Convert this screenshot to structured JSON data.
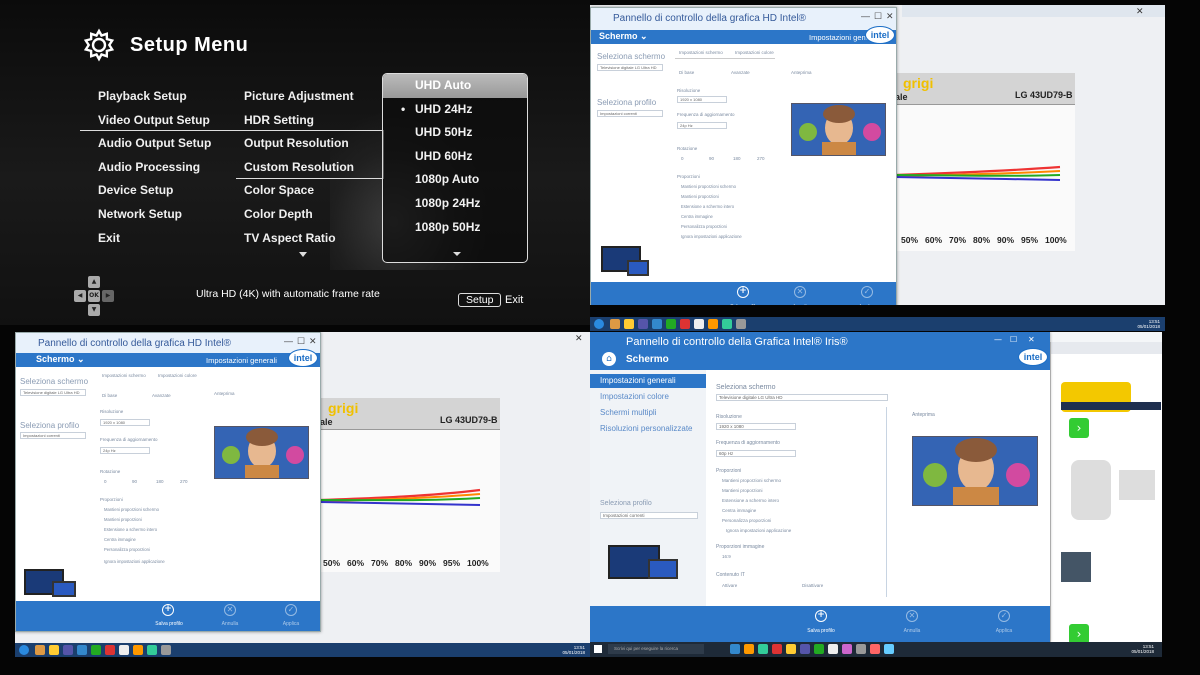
{
  "setup_menu": {
    "title": "Setup Menu",
    "main_items": [
      "Playback Setup",
      "Video Output Setup",
      "Audio Output Setup",
      "Audio Processing",
      "Device Setup",
      "Network Setup",
      "Exit"
    ],
    "sub_items": [
      "Picture Adjustment",
      "HDR Setting",
      "Output Resolution",
      "Custom Resolution",
      "Color Space",
      "Color Depth",
      "TV Aspect Ratio"
    ],
    "resolutions": [
      "UHD Auto",
      "UHD 24Hz",
      "UHD 50Hz",
      "UHD 60Hz",
      "1080p Auto",
      "1080p 24Hz",
      "1080p 50Hz"
    ],
    "selected_main": "Video Output Setup",
    "selected_sub": "Output Resolution",
    "highlighted_resolution": "UHD Auto",
    "checked_resolution": "UHD 24Hz",
    "dpad_center": "OK",
    "hint": "Ultra HD (4K) with automatic frame rate",
    "setup_key": "Setup",
    "exit_label": "Exit"
  },
  "intel_hd_win": {
    "title": "Pannello di controllo della grafica HD Intel®",
    "schermo": "Schermo ⌄",
    "impostazioni_generali": "Impostazioni generali",
    "logo": "intel",
    "seleziona_schermo": "Seleziona schermo",
    "seleziona_profilo": "Seleziona profilo",
    "display_value": "Televisione digitale LG Ultra HD",
    "profile_value": "Impostazioni correnti",
    "tab_schermo": "Impostazioni schermo",
    "tab_colore": "Impostazioni colore",
    "anteprima": "Anteprima",
    "di_base": "Di base",
    "avanzate": "Avanzate",
    "risoluzione": "Risoluzione",
    "res_value": "1920 x 1080",
    "frequenza": "Frequenza di aggiornamento",
    "freq_value": "24p Hz",
    "rotazione": "Rotazione",
    "rot_values": [
      "0",
      "90",
      "180",
      "270"
    ],
    "proporzioni": "Proporzioni",
    "prop_options": [
      "Mantieni proporzioni schermo",
      "Mantieni proporzioni",
      "Estensione a schermo intero",
      "Centra immagine",
      "Personalizza proporzioni",
      "Ignora impostazioni applicazione"
    ],
    "salva": "Salva profilo",
    "annulla": "Annulla",
    "applica": "Applica"
  },
  "intel_iris_win": {
    "title": "Pannello di controllo della Grafica Intel® Iris®",
    "schermo": "Schermo",
    "logo": "intel",
    "nav": [
      "Impostazioni generali",
      "Impostazioni colore",
      "Schermi multipli",
      "Risoluzioni personalizzate"
    ],
    "seleziona_schermo": "Seleziona schermo",
    "display_value": "Televisione digitale LG Ultra HD",
    "risoluzione": "Risoluzione",
    "res_value": "1920 x 1080",
    "frequenza": "Frequenza di aggiornamento",
    "freq_value": "60p Hz",
    "proporzioni": "Proporzioni",
    "prop_options": [
      "Mantieni proporzioni schermo",
      "Mantieni proporzioni",
      "Estensione a schermo intero",
      "Centra immagine",
      "Personalizza proporzioni",
      "Ignora impostazioni applicazione"
    ],
    "prop_immagine": "Proporzioni immagine",
    "prop_immagine_value": "16:9",
    "contenuto_it": "Contenuto IT",
    "attivare": "Attivare",
    "disattivare": "Disattivare",
    "anteprima": "Anteprima",
    "seleziona_profilo": "Seleziona profilo",
    "profile_value": "Impostazioni correnti",
    "salva": "Salva profilo",
    "annulla": "Annulla",
    "applica": "Applica",
    "search_placeholder": "Scrivi qui per eseguire la ricerca",
    "clock": "13:51\n05/01/2018"
  },
  "chart": {
    "grigi": "grigi",
    "sub": "ale",
    "model": "LG 43UD79-B",
    "ticks": [
      "50%",
      "60%",
      "70%",
      "80%",
      "90%",
      "95%",
      "100%"
    ]
  },
  "clocks": {
    "top": "13:51\n05/01/2018",
    "left": "13:51\n05/01/2018"
  },
  "colors": {
    "intel_blue": "#2c76c8",
    "taskbar": "#1b3f6e",
    "grigi_yellow": "#f0c000"
  }
}
